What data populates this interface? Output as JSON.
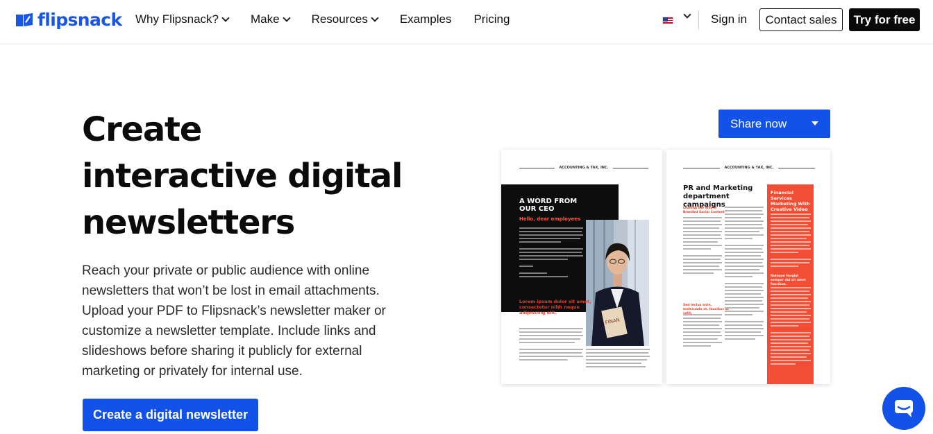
{
  "header": {
    "logo_text": "flipsnack",
    "nav": [
      {
        "label": "Why Flipsnack?",
        "has_dropdown": true
      },
      {
        "label": "Make",
        "has_dropdown": true
      },
      {
        "label": "Resources",
        "has_dropdown": true
      },
      {
        "label": "Examples",
        "has_dropdown": false
      },
      {
        "label": "Pricing",
        "has_dropdown": false
      }
    ],
    "language_icon": "us-flag-icon",
    "sign_in": "Sign in",
    "contact_sales": "Contact sales",
    "try_for_free": "Try for free"
  },
  "hero": {
    "title_lines": [
      "Create",
      "interactive digital",
      "newsletters"
    ],
    "description_lines": [
      "Reach your private or public audience with online",
      "newsletters that won’t be lost in email attachments.",
      "Upload your PDF to Flipsnack’s newsletter maker or",
      "customize a newsletter template. Include links and",
      "slideshows before sharing it publicly for external",
      "marketing or privately for internal use."
    ],
    "cta_label": "Create a digital newsletter"
  },
  "share": {
    "label": "Share now"
  },
  "newsletter_preview": {
    "left_page": {
      "header": "ACCOUNTING & TAX, INC.",
      "box_title": "A WORD FROM OUR CEO",
      "box_subtitle": "Hello, dear employees",
      "red_heading": "Lorem ipsum dolor sit amet, consectetur nibh neque adipiscing elit."
    },
    "right_page": {
      "header": "ACCOUNTING & TAX, INC.",
      "title": "PR and Marketing department campaigns",
      "sidebar_title": "Financial Services Marketing With Creative Video",
      "sub_1": "Leading the Way in Branded Social Content",
      "sub_2": "Sed lectus ante, malesuada at, faucibus ac velit.",
      "sidebar_sub": "Quisque feugiat semper dui sit amet faucibus."
    }
  },
  "colors": {
    "brand_blue": "#1252e8",
    "logo_blue": "#1a55e3",
    "accent_red": "#f24e35",
    "dark": "#0b0b0b"
  },
  "chat_icon": "chat-bubble-icon"
}
